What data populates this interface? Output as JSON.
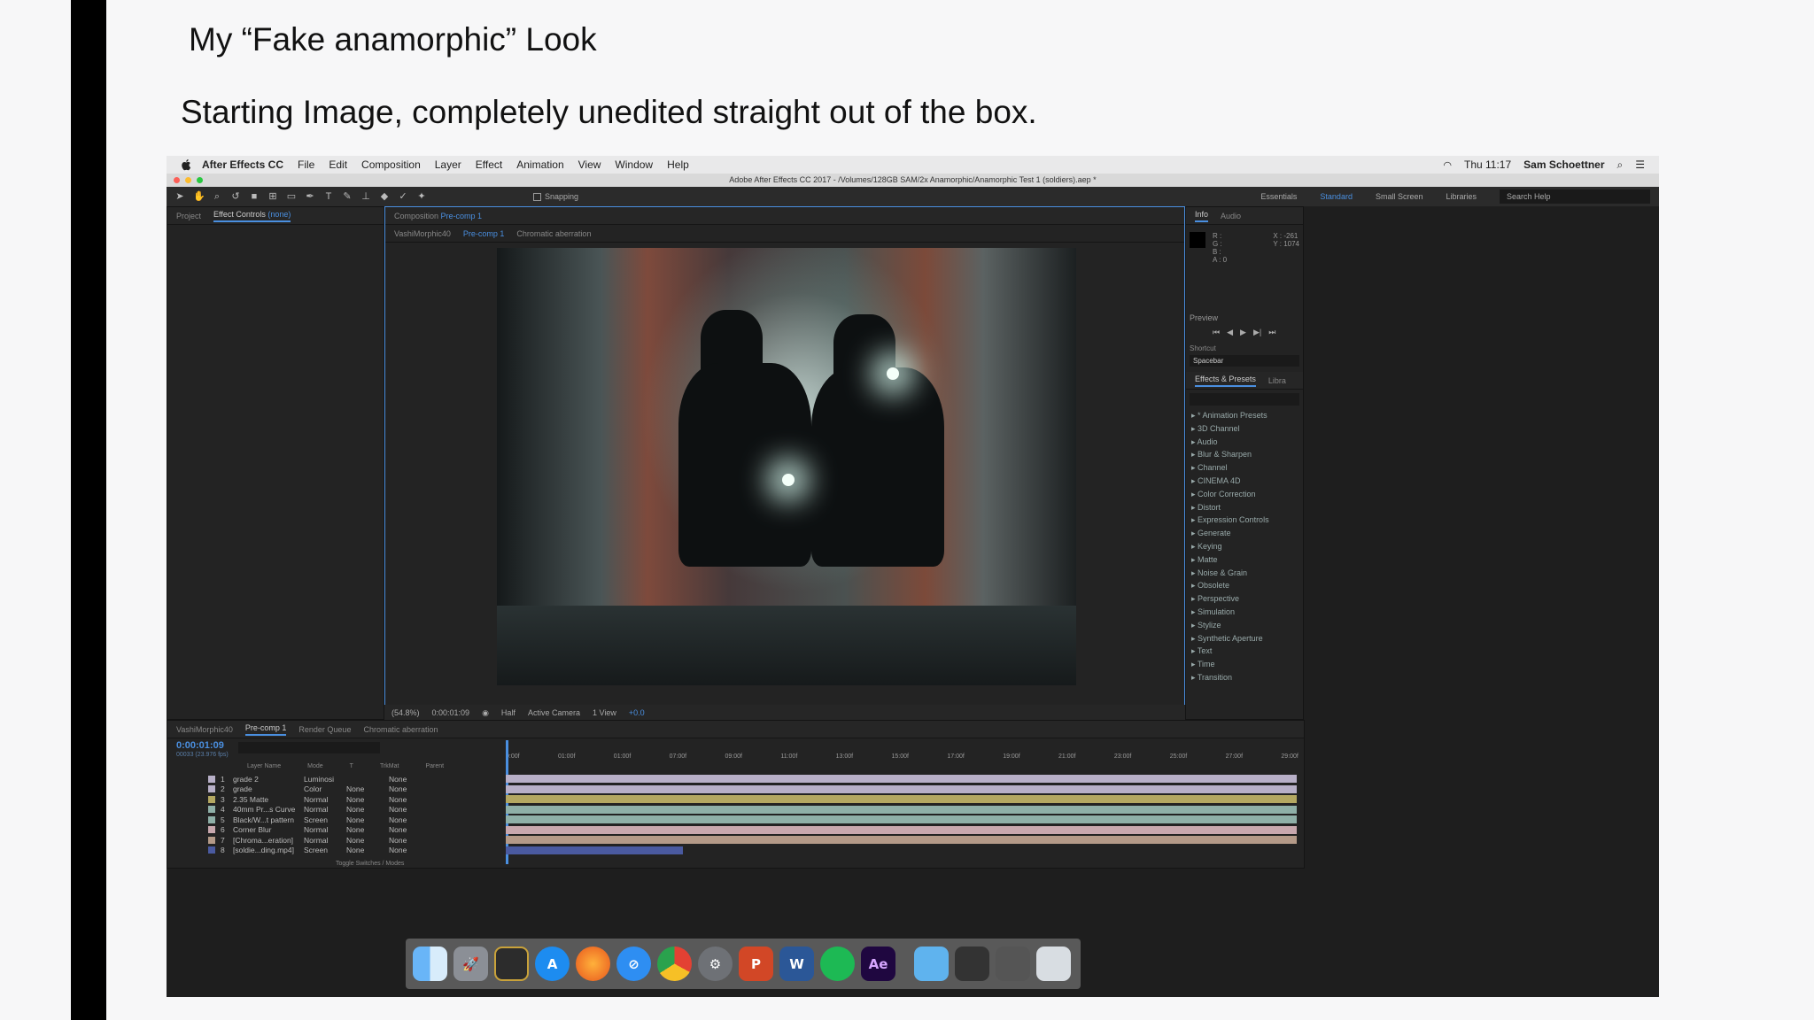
{
  "slide": {
    "title": "My “Fake anamorphic” Look",
    "subtitle": "Starting Image, completely unedited straight out of the box."
  },
  "menubar": {
    "items": [
      "After Effects CC",
      "File",
      "Edit",
      "Composition",
      "Layer",
      "Effect",
      "Animation",
      "View",
      "Window",
      "Help"
    ],
    "clock": "Thu 11:17",
    "user": "Sam Schoettner"
  },
  "window": {
    "title": "Adobe After Effects CC 2017 - /Volumes/128GB SAM/2x Anamorphic/Anamorphic Test 1 (soldiers).aep *"
  },
  "toolbar": {
    "snapping": "Snapping",
    "workspaces": [
      "Essentials",
      "Standard",
      "Small Screen",
      "Libraries"
    ],
    "search_help": "Search Help"
  },
  "left_panel": {
    "tab_project": "Project",
    "tab_effects": "Effect Controls",
    "tab_effects_value": "(none)"
  },
  "comp_panel": {
    "tab_label": "Composition",
    "tab_value": "Pre-comp 1",
    "breadcrumbs": [
      "VashiMorphic40",
      "Pre-comp 1",
      "Chromatic aberration"
    ],
    "zoom": "(54.8%)",
    "timecode": "0:00:01:09",
    "resolution": "Half",
    "camera": "Active Camera",
    "views": "1 View",
    "exposure": "+0.0"
  },
  "info_panel": {
    "tab_info": "Info",
    "tab_audio": "Audio",
    "rgba": [
      "R :",
      "G :",
      "B :",
      "A : 0"
    ],
    "coords": [
      "X : -261",
      "Y : 1074"
    ]
  },
  "preview_panel": {
    "label": "Preview",
    "shortcut_label": "Shortcut",
    "shortcut_value": "Spacebar"
  },
  "effects_panel": {
    "tab_effects": "Effects & Presets",
    "tab_libraries": "Libra",
    "items": [
      "* Animation Presets",
      "3D Channel",
      "Audio",
      "Blur & Sharpen",
      "Channel",
      "CINEMA 4D",
      "Color Correction",
      "Distort",
      "Expression Controls",
      "Generate",
      "Keying",
      "Matte",
      "Noise & Grain",
      "Obsolete",
      "Perspective",
      "Simulation",
      "Stylize",
      "Synthetic Aperture",
      "Text",
      "Time",
      "Transition"
    ]
  },
  "timeline": {
    "tabs": [
      "VashiMorphic40",
      "Pre-comp 1",
      "Render Queue",
      "Chromatic aberration"
    ],
    "timecode": "0:00:01:09",
    "frame_info": "00033 (23.976 fps)",
    "headers": [
      "Layer Name",
      "Mode",
      "T",
      "TrkMat",
      "Parent"
    ],
    "ruler": [
      "0:00f",
      "01:00f",
      "01:00f",
      "07:00f",
      "09:00f",
      "11:00f",
      "13:00f",
      "15:00f",
      "17:00f",
      "19:00f",
      "21:00f",
      "23:00f",
      "25:00f",
      "27:00f",
      "29:00f"
    ],
    "layers": [
      {
        "num": "1",
        "name": "grade 2",
        "mode": "Luminosi",
        "trk": "",
        "parent": "None",
        "color": "#b8b0c8"
      },
      {
        "num": "2",
        "name": "grade",
        "mode": "Color",
        "trk": "None",
        "parent": "None",
        "color": "#b8b0c8"
      },
      {
        "num": "3",
        "name": "2.35 Matte",
        "mode": "Normal",
        "trk": "None",
        "parent": "None",
        "color": "#b4a862"
      },
      {
        "num": "4",
        "name": "40mm Pr...s Curve",
        "mode": "Normal",
        "trk": "None",
        "parent": "None",
        "color": "#8fb0a8"
      },
      {
        "num": "5",
        "name": "Black/W...t pattern",
        "mode": "Screen",
        "trk": "None",
        "parent": "None",
        "color": "#8fb0a8"
      },
      {
        "num": "6",
        "name": "Corner Blur",
        "mode": "Normal",
        "trk": "None",
        "parent": "None",
        "color": "#c8a8ae"
      },
      {
        "num": "7",
        "name": "[Chroma...eration]",
        "mode": "Normal",
        "trk": "None",
        "parent": "None",
        "color": "#b49a88"
      },
      {
        "num": "8",
        "name": "[soldie...ding.mp4]",
        "mode": "Screen",
        "trk": "None",
        "parent": "None",
        "color": "#4a5aa0"
      }
    ],
    "footer": "Toggle Switches / Modes"
  },
  "dock": {
    "apps": [
      "finder-icon",
      "launchpad-icon",
      "photo-booth-icon",
      "app-store-icon",
      "firefox-icon",
      "safari-icon",
      "chrome-icon",
      "system-preferences-icon",
      "powerpoint-icon",
      "word-icon",
      "spotify-icon",
      "after-effects-icon",
      "folder-icon",
      "window-icon",
      "window-icon",
      "trash-icon"
    ],
    "after_effects_label": "Ae"
  }
}
